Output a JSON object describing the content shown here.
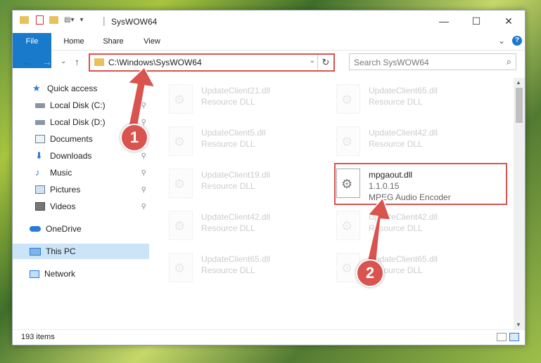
{
  "window": {
    "title": "SysWOW64",
    "minimize": "—",
    "maximize": "☐",
    "close": "✕"
  },
  "ribbon": {
    "tabs": [
      "File",
      "Home",
      "Share",
      "View"
    ],
    "expand_glyph": "⌄",
    "help_glyph": "?"
  },
  "nav": {
    "back": "←",
    "forward": "→",
    "recent": "⌄",
    "up": "↑",
    "path": "C:\\Windows\\SysWOW64",
    "dropdown": "⌄",
    "refresh": "↻",
    "search_placeholder": "Search SysWOW64",
    "search_glyph": "⌕"
  },
  "sidebar": {
    "items": [
      {
        "label": "Quick access",
        "icon": "star-icon",
        "pinned": false
      },
      {
        "label": "Local Disk (C:)",
        "icon": "drive-icon",
        "pinned": true
      },
      {
        "label": "Local Disk (D:)",
        "icon": "drive-icon",
        "pinned": true
      },
      {
        "label": "Documents",
        "icon": "documents-icon",
        "pinned": true
      },
      {
        "label": "Downloads",
        "icon": "download-icon",
        "pinned": true
      },
      {
        "label": "Music",
        "icon": "music-icon",
        "pinned": true
      },
      {
        "label": "Pictures",
        "icon": "pictures-icon",
        "pinned": true
      },
      {
        "label": "Videos",
        "icon": "videos-icon",
        "pinned": true
      },
      {
        "label": "OneDrive",
        "icon": "cloud-icon",
        "pinned": false
      },
      {
        "label": "This PC",
        "icon": "computer-icon",
        "pinned": false,
        "selected": true
      },
      {
        "label": "Network",
        "icon": "network-icon",
        "pinned": false
      }
    ],
    "pin_glyph": "📌"
  },
  "files": [
    {
      "name": "UpdateClient21.dll",
      "type": "Resource DLL"
    },
    {
      "name": "UpdateClient65.dll",
      "type": "Resource DLL"
    },
    {
      "name": "UpdateClient5.dll",
      "type": "Resource DLL"
    },
    {
      "name": "UpdateClient42.dll",
      "type": "Resource DLL"
    },
    {
      "name": "UpdateClient19.dll",
      "type": "Resource DLL"
    },
    {
      "name": "mpgaout.dll",
      "version": "1.1.0.15",
      "type": "MPEG Audio Encoder",
      "selected": true
    },
    {
      "name": "UpdateClient42.dll",
      "type": "Resource DLL"
    },
    {
      "name": "UpdateClient42.dll",
      "type": "Resource DLL"
    },
    {
      "name": "UpdateClient65.dll",
      "type": "Resource DLL"
    },
    {
      "name": "UpdateClient65.dll",
      "type": "Resource DLL"
    }
  ],
  "status": {
    "count": "193 items"
  },
  "annotations": {
    "step1": "1",
    "step2": "2",
    "accent_color": "#d9534f"
  }
}
